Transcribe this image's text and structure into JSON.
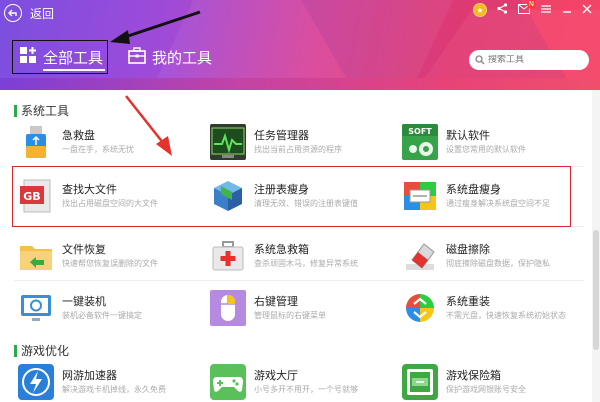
{
  "header": {
    "back_label": "返回",
    "tabs": [
      {
        "label": "全部工具",
        "active": true
      },
      {
        "label": "我的工具",
        "active": false
      }
    ],
    "search_placeholder": "搜索工具",
    "mail_badge": "N"
  },
  "sections": [
    {
      "title": "系统工具",
      "items": [
        {
          "name": "急救盘",
          "desc": "一盘在手，系统无忧",
          "icon": "usb-rescue-icon"
        },
        {
          "name": "任务管理器",
          "desc": "找出当前占用资源的程序",
          "icon": "task-monitor-icon"
        },
        {
          "name": "默认软件",
          "desc": "设置您常用的默认软件",
          "icon": "soft-gear-icon"
        },
        {
          "name": "查找大文件",
          "desc": "找出占用磁盘空间的大文件",
          "icon": "gb-file-icon"
        },
        {
          "name": "注册表瘦身",
          "desc": "清理无效、错误的注册表键值",
          "icon": "registry-cube-icon"
        },
        {
          "name": "系统盘瘦身",
          "desc": "通过瘦身解决系统盘空间不足",
          "icon": "disk-slim-icon"
        },
        {
          "name": "文件恢复",
          "desc": "快速帮您恢复误删除的文件",
          "icon": "folder-restore-icon"
        },
        {
          "name": "系统急救箱",
          "desc": "查杀顽固木马，修复异常系统",
          "icon": "first-aid-icon"
        },
        {
          "name": "磁盘擦除",
          "desc": "彻底擦除磁盘数据，保护隐私",
          "icon": "eraser-icon"
        },
        {
          "name": "一键装机",
          "desc": "装机必备软件一键搞定",
          "icon": "monitor-install-icon"
        },
        {
          "name": "右键管理",
          "desc": "管理鼠标的右键菜单",
          "icon": "mouse-icon"
        },
        {
          "name": "系统重装",
          "desc": "不需光盘，快速恢复系统初始状态",
          "icon": "windows-reinstall-icon"
        }
      ]
    },
    {
      "title": "游戏优化",
      "items": [
        {
          "name": "网游加速器",
          "desc": "解决游戏卡机掉线，永久免费",
          "icon": "lightning-icon"
        },
        {
          "name": "游戏大厅",
          "desc": "小号多开不用开，一个号就够",
          "icon": "gamepad-icon"
        },
        {
          "name": "游戏保险箱",
          "desc": "保护游戏网银账号安全",
          "icon": "safe-box-icon"
        }
      ]
    }
  ]
}
